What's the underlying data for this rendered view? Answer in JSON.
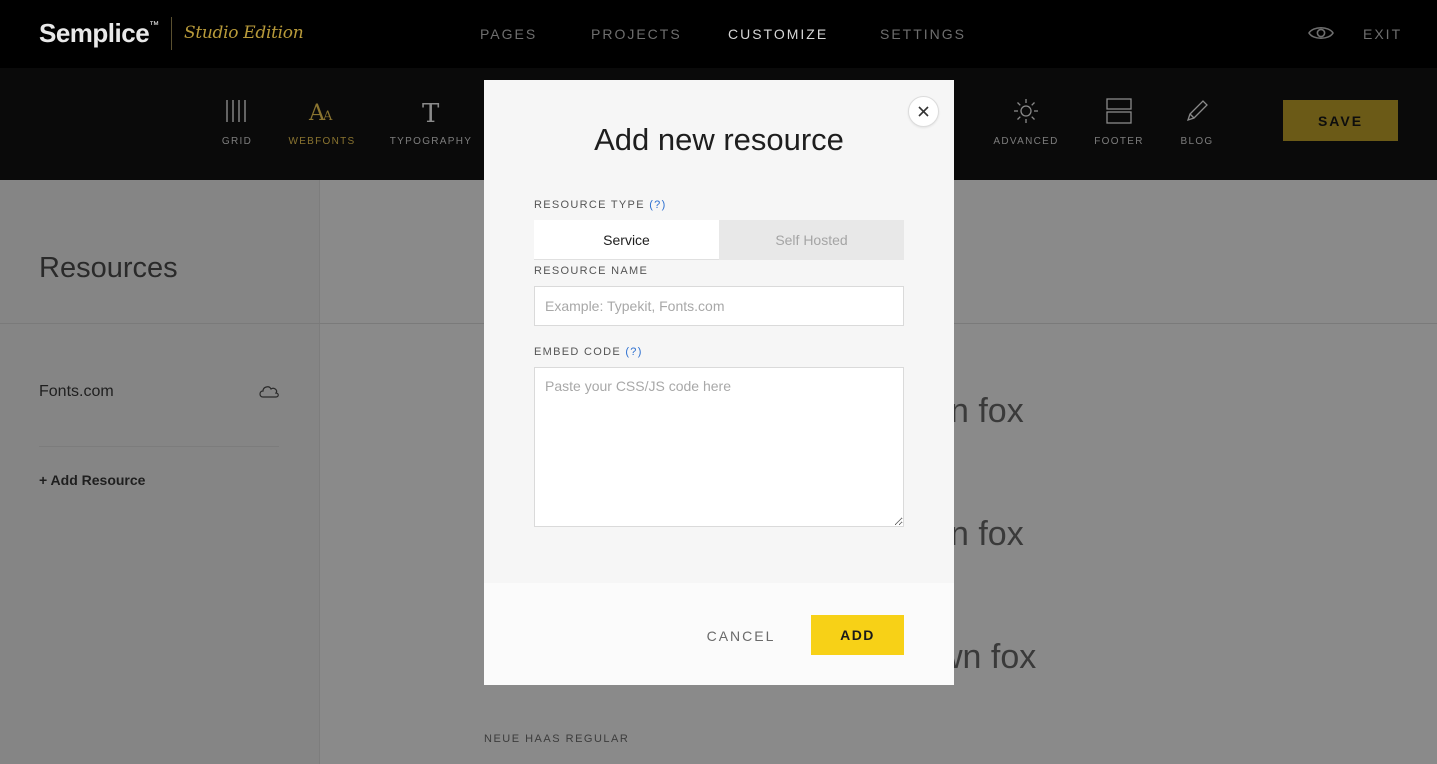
{
  "app": {
    "logo": "Semplice",
    "logo_mark": "™",
    "edition": "Studio Edition"
  },
  "nav": {
    "items": [
      {
        "label": "PAGES",
        "active": false
      },
      {
        "label": "PROJECTS",
        "active": false
      },
      {
        "label": "CUSTOMIZE",
        "active": true
      },
      {
        "label": "SETTINGS",
        "active": false
      }
    ],
    "preview_icon": "eye-icon",
    "exit_label": "EXIT"
  },
  "toolbar": {
    "tools": [
      {
        "label": "GRID",
        "icon": "grid-icon",
        "active": false
      },
      {
        "label": "WEBFONTS",
        "icon": "webfonts-icon",
        "active": true
      },
      {
        "label": "TYPOGRAPHY",
        "icon": "typography-icon",
        "active": false
      },
      {
        "label": "ADVANCED",
        "icon": "sun-icon",
        "active": false
      },
      {
        "label": "FOOTER",
        "icon": "footer-icon",
        "active": false
      },
      {
        "label": "BLOG",
        "icon": "pencil-icon",
        "active": false
      }
    ],
    "save_label": "SAVE",
    "accent_color": "#b89a3a"
  },
  "sidebar": {
    "title": "Resources",
    "items": [
      {
        "label": "Fonts.com",
        "icon": "cloud-icon"
      }
    ],
    "add_label": "+ Add Resource"
  },
  "preview": {
    "samples": [
      "n fox",
      "n fox",
      "wn fox"
    ],
    "font_label": "NEUE HAAS REGULAR"
  },
  "modal": {
    "title": "Add new resource",
    "close_icon": "close-icon",
    "resource_type_label": "RESOURCE TYPE",
    "help_label": "(?)",
    "type_options": [
      {
        "label": "Service",
        "selected": true
      },
      {
        "label": "Self Hosted",
        "selected": false
      }
    ],
    "resource_name_label": "RESOURCE NAME",
    "resource_name_value": "",
    "resource_name_placeholder": "Example: Typekit, Fonts.com",
    "embed_code_label": "EMBED CODE",
    "embed_code_value": "",
    "embed_code_placeholder": "Paste your CSS/JS code here",
    "cancel_label": "CANCEL",
    "add_label": "ADD",
    "add_color": "#f7d117"
  }
}
